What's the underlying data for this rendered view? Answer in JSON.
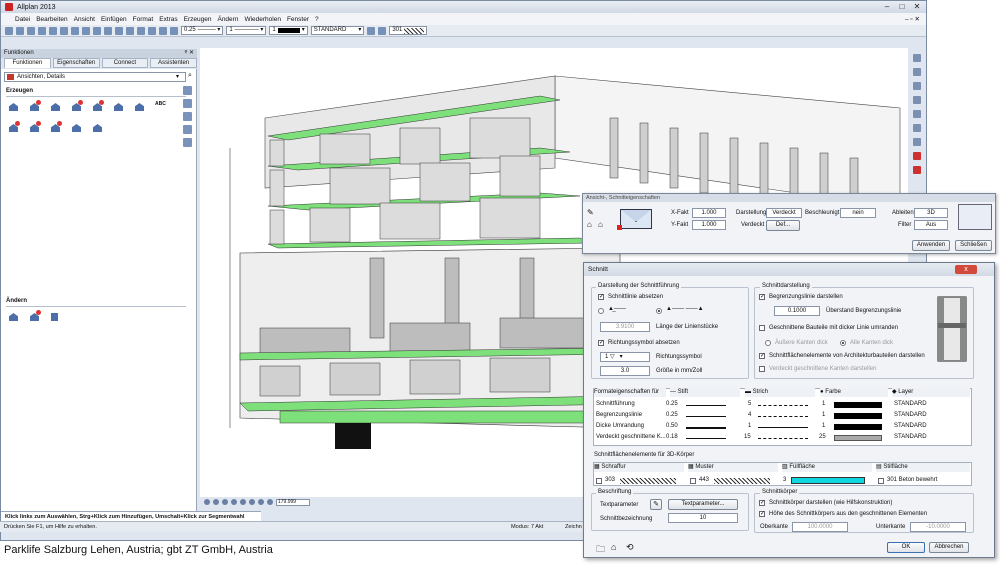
{
  "app": {
    "title": "Allplan 2013"
  },
  "menu": [
    "Datei",
    "Bearbeiten",
    "Ansicht",
    "Einfügen",
    "Format",
    "Extras",
    "Erzeugen",
    "Ändern",
    "Wiederholen",
    "Fenster",
    "?"
  ],
  "toolbar": {
    "pen": "0.25",
    "line": "1",
    "color": "1",
    "layer": "STANDARD",
    "hatch": "301"
  },
  "panel": {
    "title": "Funktionen",
    "tabs": [
      "Funktionen",
      "Eigenschaften",
      "Connect",
      "Assistenten"
    ],
    "combo": "Ansichten, Details",
    "section1": "Erzeugen",
    "section2": "Ändern",
    "abc": "ABC"
  },
  "status": {
    "message": "Klick links zum Auswählen, Strg+Klick zum Hinzufügen, Umschalt+Klick zur Segmentwahl",
    "help": "Drücken Sie F1, um Hilfe zu erhalten.",
    "modus": "Modus: 7 Akt",
    "zeichn": "Zeichn",
    "zoom": "179.999"
  },
  "ansicht_dialog": {
    "title": "Ansicht-, Schnitteigenschaften",
    "xfakt_label": "X-Fakt",
    "xfakt": "1.000",
    "yfakt_label": "Y-Fakt",
    "yfakt": "1.000",
    "darstellung_label": "Darstellung",
    "darstellung": "Verdeckt",
    "beschleunigt_label": "Beschleunigt",
    "beschleunigt": "nein",
    "ableiten_label": "Ableiten",
    "ableiten": "3D",
    "verdeckt_label": "Verdeckt",
    "verdeckt": "Def...",
    "filter_label": "Filter",
    "filter": "Aus",
    "anwenden": "Anwenden",
    "schliessen": "Schließen"
  },
  "schnitt": {
    "title": "Schnitt",
    "close": "x",
    "grp1": "Darstellung der Schnittführung",
    "schnittlinie": "Schnittlinie absetzen",
    "laenge": "3.9100",
    "laenge_label": "Länge der Linienstücke",
    "richtung": "Richtungssymbol absetzen",
    "rsym": "1",
    "rsym_label": "Richtungssymbol",
    "groesse": "3.0",
    "groesse_label": "Größe in mm/Zoll",
    "grp2": "Schnittdarstellung",
    "begrenzung": "Begrenzungslinie darstellen",
    "ueberstand": "0.1000",
    "ueberstand_label": "Überstand Begrenzungslinie",
    "dicker": "Geschnittene Bauteile mit dicker Linie umranden",
    "aussen": "Äußere Kanten dick",
    "alle": "Alle Kanten dick",
    "flaechen": "Schnittflächenelemente von Architekturbauteilen darstellen",
    "verdecktk": "Verdeckt geschnittene Kanten darstellen",
    "table_head": [
      "Formateigenschaften für",
      "Stift",
      "Strich",
      "Farbe",
      "Layer"
    ],
    "rows": [
      {
        "name": "Schnittführung",
        "pen": "0.25",
        "strich": "5",
        "farbe": "1",
        "layer": "STANDARD"
      },
      {
        "name": "Begrenzungslinie",
        "pen": "0.25",
        "strich": "4",
        "farbe": "1",
        "layer": "STANDARD"
      },
      {
        "name": "Dicke Umrandung",
        "pen": "0.50",
        "strich": "1",
        "farbe": "1",
        "layer": "STANDARD"
      },
      {
        "name": "Verdeckt geschnittene K...",
        "pen": "0.18",
        "strich": "15",
        "farbe": "25",
        "layer": "STANDARD"
      }
    ],
    "grp3": "Schnittflächenelemente für 3D-Körper",
    "t2_head": [
      "Schraffur",
      "Muster",
      "Füllfläche",
      "Stilfläche"
    ],
    "schraffur": "303",
    "muster": "443",
    "fuell": "3",
    "stil": "301 Beton bewehrt",
    "grp4": "Beschriftung",
    "textparam_label": "Textparameter",
    "textparam_btn": "Textparameter...",
    "bez_label": "Schnittbezeichnung",
    "bez": "10",
    "grp5": "Schnittkörper",
    "koerper": "Schnittkörper darstellen (wie Hilfskonstruktion)",
    "hoehe": "Höhe des Schnittkörpers aus den geschnittenen Elementen",
    "oberkante_label": "Oberkante",
    "oberkante": "100.0000",
    "unterkante_label": "Unterkante",
    "unterkante": "-10.0000",
    "ok": "OK",
    "abbrechen": "Abbrechen"
  },
  "caption": "Parklife Salzburg Lehen, Austria; gbt ZT GmbH, Austria"
}
